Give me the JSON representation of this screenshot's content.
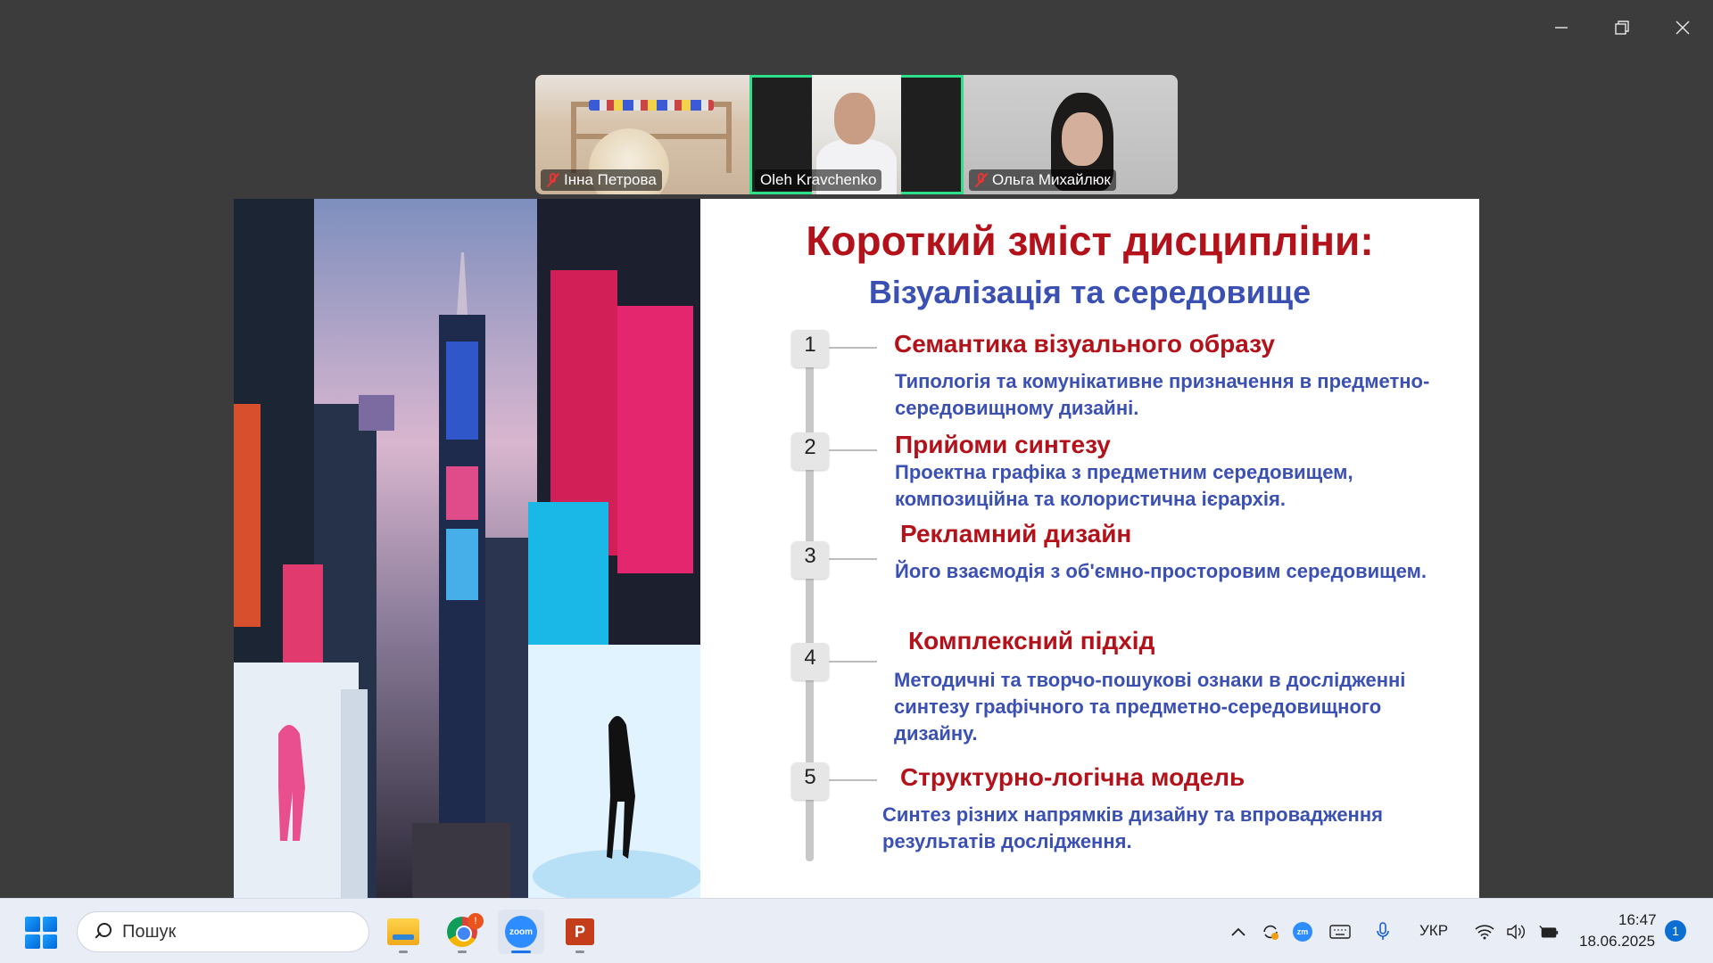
{
  "window": {
    "controls": {
      "minimize": "minimize-icon",
      "restore": "restore-icon",
      "close": "close-icon"
    }
  },
  "participants": [
    {
      "name": "Інна Петрова",
      "muted": true,
      "active": false
    },
    {
      "name": "Oleh Kravchenko",
      "muted": false,
      "active": true
    },
    {
      "name": "Ольга Михайлюк",
      "muted": true,
      "active": false
    }
  ],
  "slide": {
    "title": "Короткий зміст дисципліни:",
    "subtitle": "Візуалізація та середовище",
    "items": [
      {
        "num": "1",
        "heading": "Семантика візуального образу",
        "desc": "Типологія та комунікативне призначення в предметно-середовищному дизайні."
      },
      {
        "num": "2",
        "heading": "Прийоми синтезу",
        "desc": "Проектна графіка з предметним середовищем, композиційна та колористична ієрархія."
      },
      {
        "num": "3",
        "heading": "Рекламний дизайн",
        "desc": "Його взаємодія з об'ємно-просторовим середовищем."
      },
      {
        "num": "4",
        "heading": "Комплексний підхід",
        "desc": "Методичні та творчо-пошукові ознаки в дослідженні синтезу графічного та предметно-середовищного дизайну."
      },
      {
        "num": "5",
        "heading": "Структурно-логічна модель",
        "desc": "Синтез різних напрямків дизайну та впровадження результатів дослідження."
      }
    ],
    "colors": {
      "heading": "#b3121a",
      "body": "#3b50b3"
    }
  },
  "taskbar": {
    "search_placeholder": "Пошук",
    "apps": [
      "file-explorer",
      "chrome",
      "zoom",
      "powerpoint"
    ],
    "chrome_badge": "!",
    "zoom_label": "zoom",
    "ppt_label": "P",
    "language": "УКР",
    "time": "16:47",
    "date": "18.06.2025",
    "notification_count": "1",
    "zoom_tray_label": "zm"
  }
}
